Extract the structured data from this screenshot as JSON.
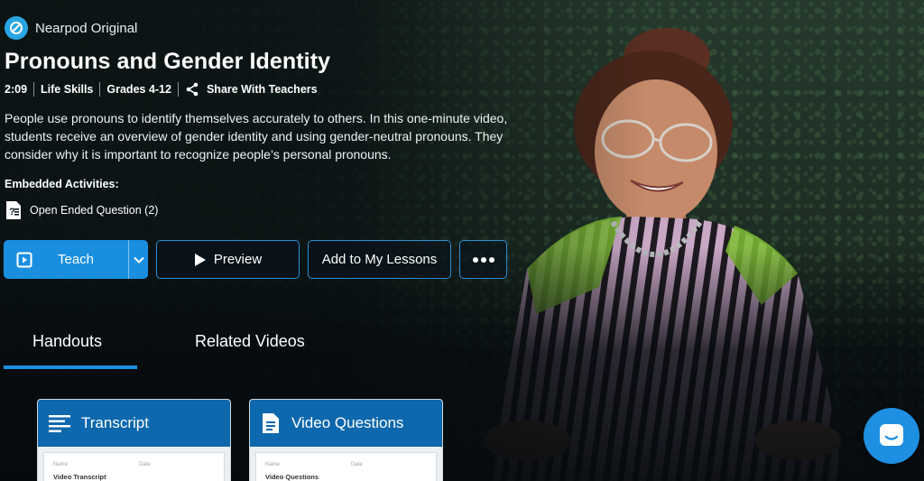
{
  "brand": {
    "name": "Nearpod Original"
  },
  "lesson": {
    "title": "Pronouns and Gender Identity",
    "duration": "2:09",
    "subject": "Life Skills",
    "grades": "Grades 4-12",
    "share_label": "Share With Teachers",
    "description": "People use pronouns to identify themselves accurately to others. In this one-minute video, students receive an overview of gender identity and using gender-neutral pronouns. They consider why it is important to recognize people’s personal pronouns."
  },
  "activities": {
    "heading": "Embedded Activities:",
    "items": [
      {
        "label": "Open Ended Question (2)"
      }
    ]
  },
  "buttons": {
    "teach": "Teach",
    "preview": "Preview",
    "add_to_lessons": "Add to My Lessons"
  },
  "tabs": [
    {
      "label": "Handouts",
      "active": true
    },
    {
      "label": "Related Videos",
      "active": false
    }
  ],
  "cards": [
    {
      "title": "Transcript",
      "preview_title": "Video Transcript",
      "preview_name": "Name",
      "preview_date": "Date"
    },
    {
      "title": "Video Questions",
      "preview_title": "Video Questions",
      "preview_name": "Name",
      "preview_date": "Date"
    }
  ],
  "colors": {
    "accent": "#1a8fe0",
    "card_header": "#0d68ad",
    "logo": "#27a6e4"
  }
}
